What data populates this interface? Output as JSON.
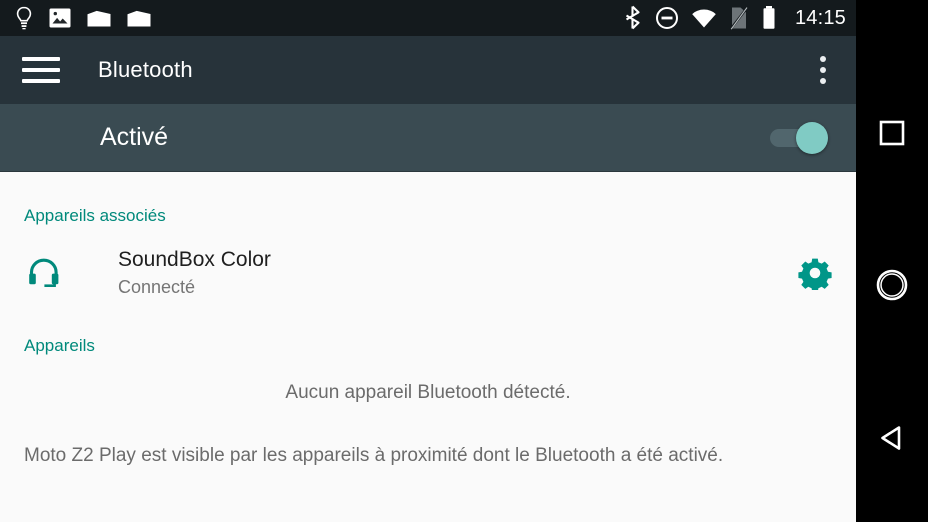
{
  "status_bar": {
    "left_icons": [
      "lightbulb-icon",
      "image-icon",
      "folder-icon",
      "folder-icon"
    ],
    "right_icons": [
      "bluetooth-icon",
      "do-not-disturb-icon",
      "wifi-icon",
      "no-sim-icon",
      "battery-icon"
    ],
    "clock": "14:15"
  },
  "app_bar": {
    "menu_icon": "hamburger-icon",
    "title": "Bluetooth",
    "overflow_icon": "more-vertical-icon"
  },
  "toggle_bar": {
    "state_label": "Activé",
    "switch_on": true,
    "switch_thumb_color": "#80cbc4",
    "switch_track_color": "#51666d"
  },
  "content": {
    "paired_section_header": "Appareils associés",
    "paired_devices": [
      {
        "icon": "headset-icon",
        "name": "SoundBox Color",
        "status": "Connecté",
        "settings_icon": "gear-icon"
      }
    ],
    "available_section_header": "Appareils",
    "empty_message": "Aucun appareil Bluetooth détecté.",
    "visibility_message": "Moto Z2 Play est visible par les appareils à proximité dont le Bluetooth a été activé.",
    "accent_color": "#00897b",
    "background_color": "#fafafa"
  },
  "nav_bar": {
    "recents_label": "recents-square-icon",
    "home_label": "home-circle-icon",
    "back_label": "back-triangle-icon"
  }
}
